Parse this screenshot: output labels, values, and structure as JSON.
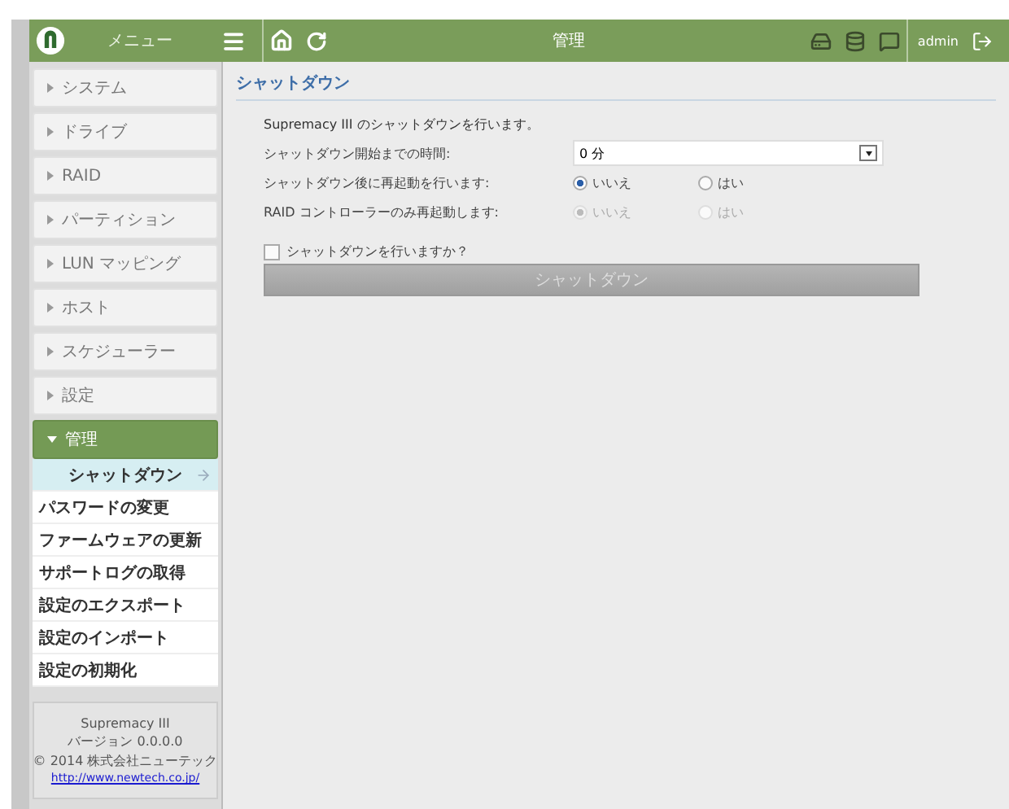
{
  "top_bar": {
    "menu_label": "メニュー",
    "title": "管理",
    "user": "admin"
  },
  "sidebar": {
    "items": [
      {
        "label": "システム",
        "expanded": false
      },
      {
        "label": "ドライブ",
        "expanded": false
      },
      {
        "label": "RAID",
        "expanded": false
      },
      {
        "label": "パーティション",
        "expanded": false
      },
      {
        "label": "LUN マッピング",
        "expanded": false
      },
      {
        "label": "ホスト",
        "expanded": false
      },
      {
        "label": "スケジューラー",
        "expanded": false
      },
      {
        "label": "設定",
        "expanded": false
      },
      {
        "label": "管理",
        "expanded": true,
        "children": [
          {
            "label": "シャットダウン",
            "selected": true
          },
          {
            "label": "パスワードの変更",
            "selected": false
          },
          {
            "label": "ファームウェアの更新",
            "selected": false
          },
          {
            "label": "サポートログの取得",
            "selected": false
          },
          {
            "label": "設定のエクスポート",
            "selected": false
          },
          {
            "label": "設定のインポート",
            "selected": false
          },
          {
            "label": "設定の初期化",
            "selected": false
          }
        ]
      }
    ],
    "footer": {
      "product": "Supremacy III",
      "version": "バージョン 0.0.0.0",
      "copyright": "© 2014 株式会社ニューテック",
      "link": "http://www.newtech.co.jp/"
    }
  },
  "content": {
    "heading": "シャットダウン",
    "intro": "Supremacy III のシャットダウンを行います。",
    "fields": [
      {
        "kind": "select",
        "label": "シャットダウン開始までの時間:",
        "value": "0 分"
      },
      {
        "kind": "radio",
        "label": "シャットダウン後に再起動を行います:",
        "disabled": false,
        "options": [
          {
            "label": "いいえ",
            "selected": true
          },
          {
            "label": "はい",
            "selected": false
          }
        ]
      },
      {
        "kind": "radio",
        "label": "RAID コントローラーのみ再起動します:",
        "disabled": true,
        "options": [
          {
            "label": "いいえ",
            "selected": true
          },
          {
            "label": "はい",
            "selected": false
          }
        ]
      }
    ],
    "confirm": {
      "label": "シャットダウンを行いますか？",
      "checked": false
    },
    "button": {
      "label": "シャットダウン",
      "disabled": true
    }
  }
}
